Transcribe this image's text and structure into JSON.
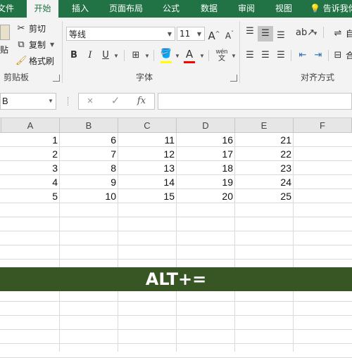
{
  "ribbon_tabs": [
    "文件",
    "开始",
    "插入",
    "页面布局",
    "公式",
    "数据",
    "审阅",
    "视图"
  ],
  "active_tab": "开始",
  "tell_me": "告诉我你",
  "clipboard": {
    "paste_label": "粘贴",
    "cut_label": "剪切",
    "copy_label": "复制",
    "format_painter_label": "格式刷",
    "group_label": "剪贴板"
  },
  "font": {
    "font_name": "等线",
    "font_size": "11",
    "grow_label": "A",
    "shrink_label": "A",
    "bold": "B",
    "italic": "I",
    "underline": "U",
    "font_color_label": "A",
    "phonetic_label": "wén",
    "group_label": "字体"
  },
  "alignment": {
    "group_label": "对齐方式",
    "wrap_label": "自",
    "merge_label": "合"
  },
  "formula_bar": {
    "name_box": "B",
    "cancel_icon": "×",
    "enter_icon": "✓",
    "fx_label": "fx",
    "formula": ""
  },
  "columns": [
    "A",
    "B",
    "C",
    "D",
    "E",
    "F"
  ],
  "grid": {
    "rows": [
      [
        "1",
        "6",
        "11",
        "16",
        "21",
        ""
      ],
      [
        "2",
        "7",
        "12",
        "17",
        "22",
        ""
      ],
      [
        "3",
        "8",
        "13",
        "18",
        "23",
        ""
      ],
      [
        "4",
        "9",
        "14",
        "19",
        "24",
        ""
      ],
      [
        "5",
        "10",
        "15",
        "20",
        "25",
        ""
      ]
    ]
  },
  "banner": {
    "text": "ALT+=",
    "color": "#375623"
  },
  "colors": {
    "accent": "#217346",
    "ribbon_bg": "#f3f3f3",
    "header_bg": "#e6e6e6"
  }
}
